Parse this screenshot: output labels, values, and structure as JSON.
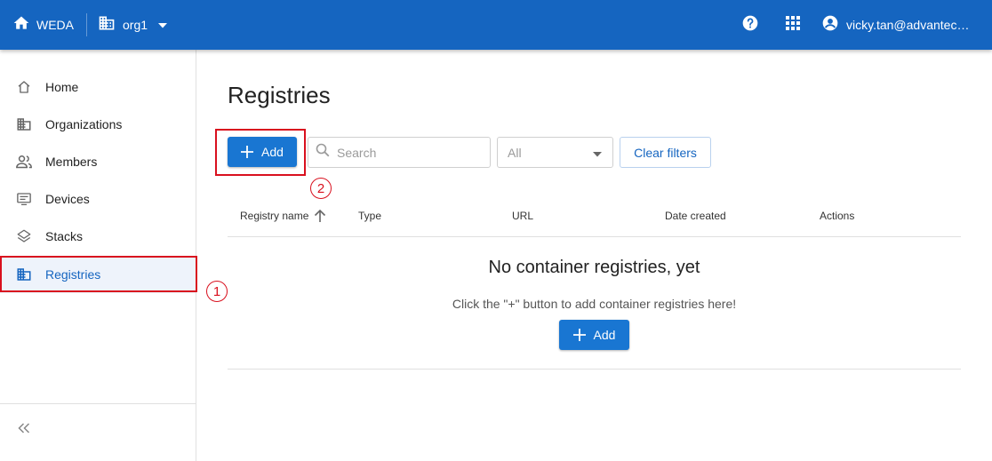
{
  "topbar": {
    "brand_label": "WEDA",
    "org_label": "org1",
    "user_label": "vicky.tan@advantech.com",
    "icons": [
      "home-icon",
      "building-icon",
      "caret-down-icon",
      "help-icon",
      "apps-grid-icon",
      "account-icon"
    ]
  },
  "sidebar": {
    "items": [
      {
        "label": "Home",
        "icon": "home-outline-icon"
      },
      {
        "label": "Organizations",
        "icon": "building-icon"
      },
      {
        "label": "Members",
        "icon": "people-icon"
      },
      {
        "label": "Devices",
        "icon": "device-icon"
      },
      {
        "label": "Stacks",
        "icon": "layers-icon"
      },
      {
        "label": "Registries",
        "icon": "building-icon"
      }
    ],
    "active": "Registries",
    "collapse_icon": "double-chevron-left-icon"
  },
  "main": {
    "title": "Registries",
    "add_label": "Add",
    "search_placeholder": "Search",
    "filter_value": "All",
    "clear_filters_label": "Clear filters",
    "columns": [
      "Registry name",
      "Type",
      "URL",
      "Date created",
      "Actions"
    ],
    "empty_title": "No container registries, yet",
    "empty_subtitle": "Click the \"+\" button to add container registries here!",
    "empty_add_label": "Add"
  },
  "annotations": {
    "step1": "1",
    "step2": "2"
  },
  "colors": {
    "topbar": "#1565c0",
    "primary": "#1976d2",
    "highlight": "#d9101e",
    "active_bg": "#eef3fb"
  }
}
